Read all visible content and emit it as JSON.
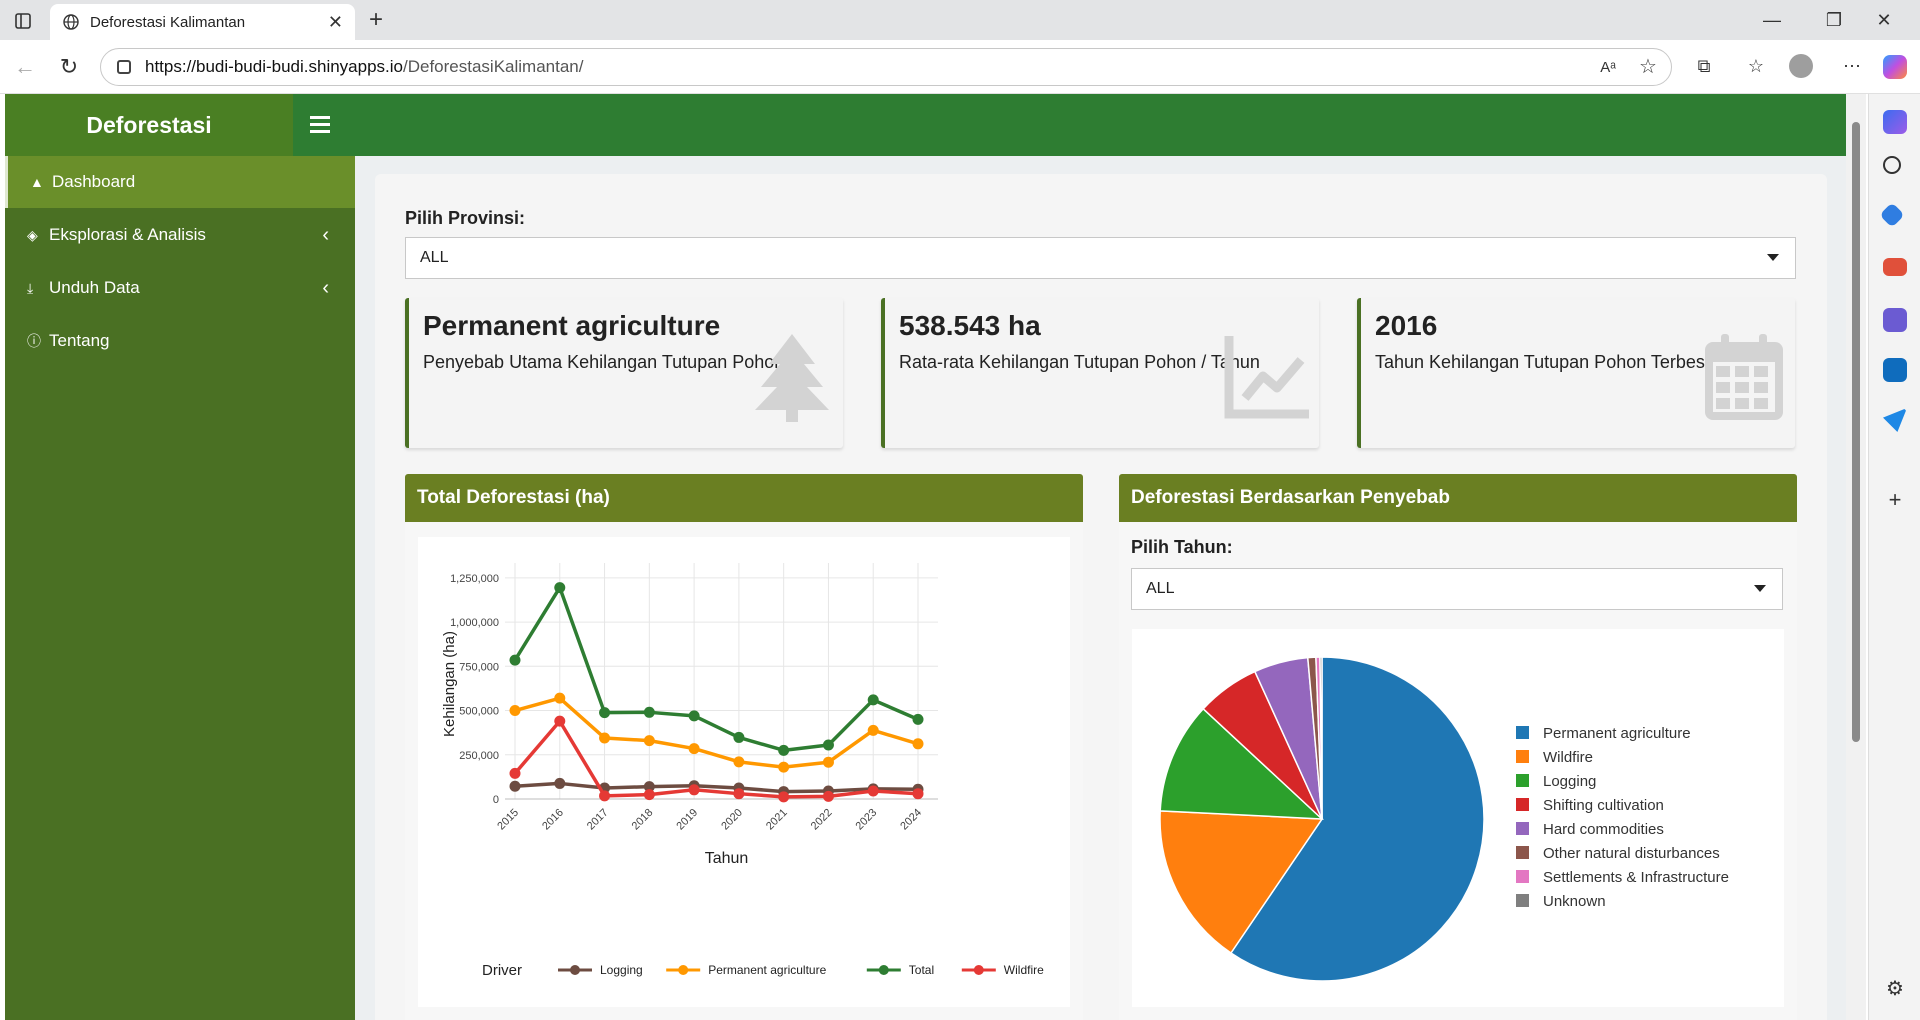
{
  "browser": {
    "tab_title": "Deforestasi Kalimantan",
    "url_host": "https://budi-budi-budi.shinyapps.io",
    "url_path": "/DeforestasiKalimantan/"
  },
  "app": {
    "brand": "Deforestasi",
    "menu": [
      {
        "label": "Dashboard",
        "icon": "dashboard-icon",
        "active": true
      },
      {
        "label": "Eksplorasi & Analisis",
        "icon": "layers-icon",
        "has_submenu": true
      },
      {
        "label": "Unduh Data",
        "icon": "download-icon",
        "has_submenu": true
      },
      {
        "label": "Tentang",
        "icon": "info-icon"
      }
    ]
  },
  "filters": {
    "provinsi_label": "Pilih Provinsi:",
    "provinsi_value": "ALL",
    "tahun_label": "Pilih Tahun:",
    "tahun_value": "ALL"
  },
  "value_boxes": [
    {
      "value": "Permanent agriculture",
      "subtitle": "Penyebab Utama Kehilangan Tutupan Pohon",
      "icon": "tree-icon"
    },
    {
      "value": "538.543 ha",
      "subtitle": "Rata-rata Kehilangan Tutupan Pohon / Tahun",
      "icon": "line-chart-icon"
    },
    {
      "value": "2016",
      "subtitle": "Tahun Kehilangan Tutupan Pohon Terbesar",
      "icon": "calendar-icon"
    }
  ],
  "panels": {
    "line_title": "Total Deforestasi (ha)",
    "pie_title": "Deforestasi Berdasarkan Penyebab"
  },
  "colors": {
    "header": "#2e7d32",
    "sidebar": "#4a7023",
    "panel_head": "#6a7f22"
  },
  "chart_data": [
    {
      "type": "line",
      "xlabel": "Tahun",
      "ylabel": "Kehilangan (ha)",
      "legend_title": "Driver",
      "x": [
        "2015",
        "2016",
        "2017",
        "2018",
        "2019",
        "2020",
        "2021",
        "2022",
        "2023",
        "2024"
      ],
      "ylim": [
        0,
        1300000
      ],
      "yticks": [
        "0",
        "250,000",
        "500,000",
        "750,000",
        "1,000,000",
        "1,250,000"
      ],
      "legend_position": "bottom",
      "grid": true,
      "series": [
        {
          "name": "Logging",
          "color": "#6d4c41",
          "values": [
            72000,
            88000,
            62000,
            70000,
            75000,
            62000,
            42000,
            45000,
            57000,
            55000
          ]
        },
        {
          "name": "Permanent agriculture",
          "color": "#ff9800",
          "values": [
            500000,
            570000,
            345000,
            330000,
            285000,
            210000,
            180000,
            208000,
            388000,
            312000
          ]
        },
        {
          "name": "Total",
          "color": "#2e7d32",
          "values": [
            785000,
            1195000,
            488000,
            490000,
            470000,
            348000,
            275000,
            305000,
            560000,
            450000
          ]
        },
        {
          "name": "Wildfire",
          "color": "#e53935",
          "values": [
            145000,
            440000,
            18000,
            25000,
            52000,
            30000,
            12000,
            15000,
            45000,
            30000
          ]
        }
      ]
    },
    {
      "type": "pie",
      "legend_position": "right",
      "categories": [
        "Permanent agriculture",
        "Wildfire",
        "Logging",
        "Shifting cultivation",
        "Hard commodities",
        "Other natural disturbances",
        "Settlements & Infrastructure",
        "Unknown"
      ],
      "values": [
        59.5,
        16.3,
        11.1,
        6.3,
        5.4,
        0.8,
        0.4,
        0.2
      ],
      "colors": [
        "#1f77b4",
        "#ff7f0e",
        "#2ca02c",
        "#d62728",
        "#9467bd",
        "#8c564b",
        "#e377c2",
        "#7f7f7f"
      ]
    }
  ]
}
